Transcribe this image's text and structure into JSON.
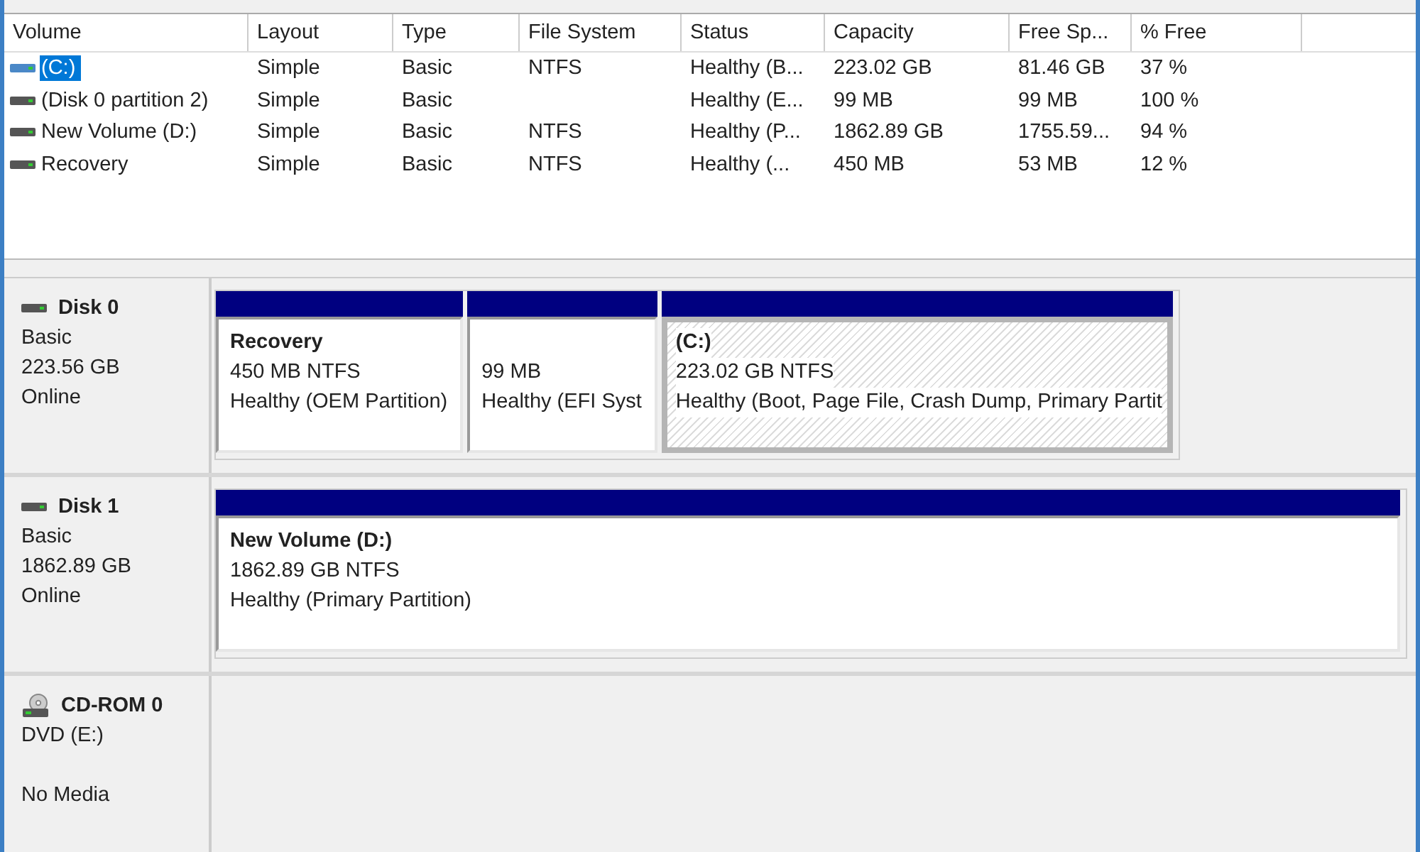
{
  "table": {
    "columns": [
      "Volume",
      "Layout",
      "Type",
      "File System",
      "Status",
      "Capacity",
      "Free Sp...",
      "% Free"
    ],
    "rows": [
      {
        "volume": "(C:)",
        "layout": "Simple",
        "type": "Basic",
        "file_system": "NTFS",
        "status": "Healthy (B...",
        "capacity": "223.02 GB",
        "free_space": "81.46 GB",
        "percent_free": "37 %",
        "selected": true
      },
      {
        "volume": "(Disk 0 partition 2)",
        "layout": "Simple",
        "type": "Basic",
        "status": "Healthy (E...",
        "capacity": "99 MB",
        "free_space": "99 MB",
        "percent_free": "100 %",
        "selected": false
      },
      {
        "volume": "New Volume (D:)",
        "layout": "Simple",
        "type": "Basic",
        "file_system": "NTFS",
        "status": "Healthy (P...",
        "capacity": "1862.89 GB",
        "free_space": "1755.59...",
        "percent_free": "94 %",
        "selected": false
      },
      {
        "volume": "Recovery",
        "layout": "Simple",
        "type": "Basic",
        "file_system": "NTFS",
        "status": "Healthy (...",
        "capacity": "450 MB",
        "free_space": "53 MB",
        "percent_free": "12 %",
        "selected": false
      }
    ]
  },
  "disks": [
    {
      "kind": "disk",
      "name": "Disk 0",
      "type": "Basic",
      "size": "223.56 GB",
      "status": "Online",
      "partitions": [
        {
          "title": "Recovery",
          "size": "450 MB NTFS",
          "status": "Healthy (OEM Partition)",
          "selected": false
        },
        {
          "size": "99 MB",
          "status": "Healthy (EFI Syst",
          "selected": false
        },
        {
          "title": "(C:)",
          "size": "223.02 GB NTFS",
          "status": "Healthy (Boot, Page File, Crash Dump, Primary Partit",
          "selected": true
        }
      ]
    },
    {
      "kind": "disk",
      "name": "Disk 1",
      "type": "Basic",
      "size": "1862.89 GB",
      "status": "Online",
      "partitions": [
        {
          "title": "New Volume  (D:)",
          "size": "1862.89 GB NTFS",
          "status": "Healthy (Primary Partition)",
          "selected": false
        }
      ]
    },
    {
      "kind": "cdrom",
      "name": "CD-ROM 0",
      "type": "DVD (E:)",
      "status": "No Media"
    }
  ]
}
